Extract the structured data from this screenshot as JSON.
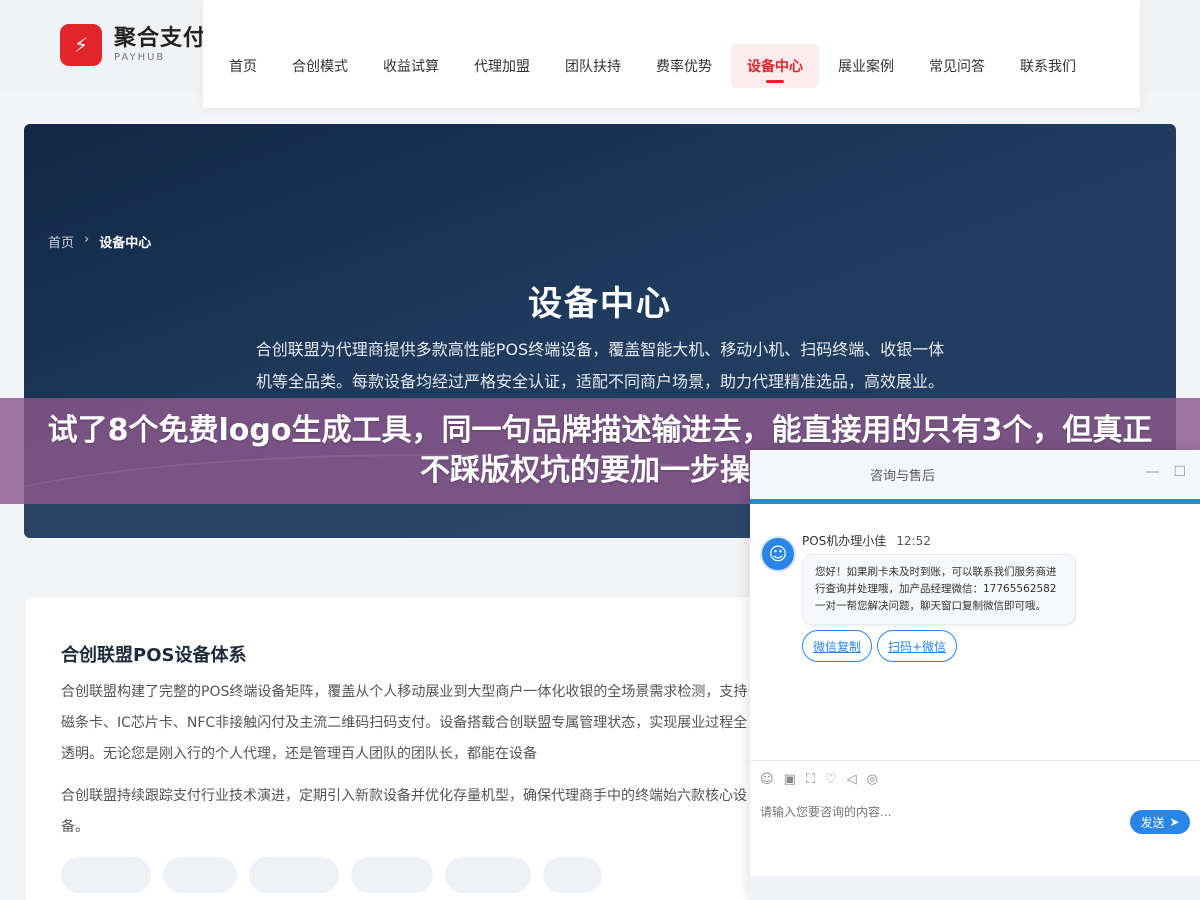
{
  "brand": {
    "name": "聚合支付",
    "sub": "PAYHUB",
    "icon": "lightning-icon"
  },
  "nav": [
    {
      "label": "首页"
    },
    {
      "label": "合创模式"
    },
    {
      "label": "收益试算"
    },
    {
      "label": "代理加盟"
    },
    {
      "label": "团队扶持"
    },
    {
      "label": "费率优势"
    },
    {
      "label": "设备中心",
      "active": true
    },
    {
      "label": "展业案例"
    },
    {
      "label": "常见问答"
    },
    {
      "label": "联系我们"
    }
  ],
  "hero": {
    "breadcrumb": {
      "home": "首页",
      "sep": "›",
      "current": "设备中心"
    },
    "title": "设备中心",
    "desc": "合创联盟为代理商提供多款高性能POS终端设备，覆盖智能大机、移动小机、扫码终端、收银一体机等全品类。每款设备均经过严格安全认证，适配不同商户场景，助力代理精准选品，高效展业。"
  },
  "card": {
    "title": "合创联盟POS设备体系",
    "p1": "合创联盟构建了完整的POS终端设备矩阵，覆盖从个人移动展业到大型商户一体化收银的全场景需求检测，支持磁条卡、IC芯片卡、NFC非接触闪付及主流二维码扫码支付。设备搭载合创联盟专属管理状态，实现展业过程全透明。无论您是刚入行的个人代理，还是管理百人团队的团队长，都能在设备",
    "p2": "合创联盟持续跟踪支付行业技术演进，定期引入新款设备并优化存量机型，确保代理商手中的终端始六款核心设备。"
  },
  "banner": {
    "text": "试了8个免费logo生成工具，同一句品牌描述输进去，能直接用的只有3个，但真正不踩版权坑的要加一步操作"
  },
  "chat": {
    "header_title": "咨询与售后",
    "agent_name": "POS机办理小佳",
    "time": "12:52",
    "message": "您好！如果刷卡未及时到账，可以联系我们服务商进行查询并处理哦，加产品经理微信：17765562582 一对一帮您解决问题，聊天窗口复制微信即可哦。",
    "quick_replies": [
      "微信复制",
      "扫码+微信"
    ],
    "input_placeholder": "请输入您要咨询的内容...",
    "send_label": "发送",
    "minimize": "—",
    "maximize": "☐"
  },
  "colors": {
    "accent": "#e2242b",
    "chat_blue": "#2a86e6",
    "banner": "#8c588c"
  }
}
